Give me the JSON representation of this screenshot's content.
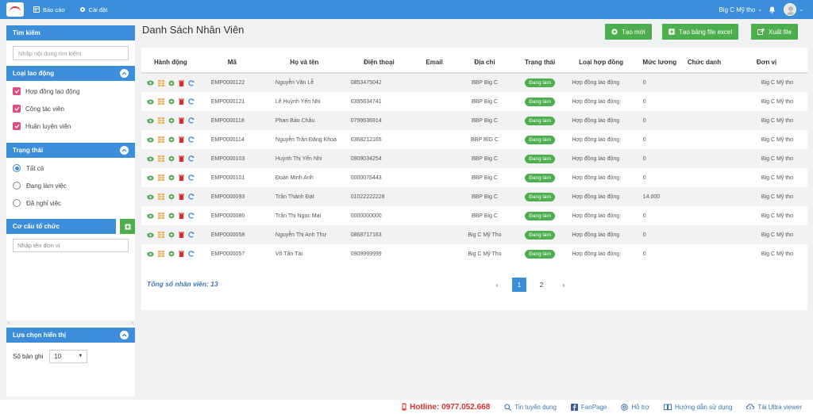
{
  "topbar": {
    "nav": [
      {
        "label": "Báo cáo",
        "icon": "report-icon"
      },
      {
        "label": "Cài đặt",
        "icon": "gear-icon"
      }
    ],
    "store": "Big C Mỹ tho",
    "brand_color": "#3c8dda"
  },
  "sidebar": {
    "search_title": "Tìm kiếm",
    "search_placeholder": "Nhập nội dung tìm kiếm",
    "labor_type_title": "Loại lao động",
    "labor_types": [
      "Hợp đồng lao động",
      "Cộng tác viên",
      "Huấn luyện viên"
    ],
    "status_title": "Trạng thái",
    "status_options": [
      "Tất cả",
      "Đang làm việc",
      "Đã nghỉ việc"
    ],
    "org_title": "Cơ cấu tổ chức",
    "org_placeholder": "Nhập tên đơn vị",
    "display_title": "Lựa chọn hiển thị",
    "records_label": "Số bản ghi",
    "records_value": "10"
  },
  "main": {
    "title": "Danh Sách Nhân Viên",
    "buttons": {
      "create": "Tạo mới",
      "excel": "Tạo bảng file excel",
      "export": "Xuất file"
    },
    "columns": [
      "Hành động",
      "Mã",
      "Họ và tên",
      "Điện thoại",
      "Email",
      "Địa chỉ",
      "Trạng thái",
      "Loại hợp đồng",
      "Mức lương",
      "Chức danh",
      "Đơn vị"
    ],
    "rows": [
      {
        "code": "EMP0000122",
        "name": "Nguyễn Văn Lễ",
        "phone": "0853475042",
        "email": "",
        "address": "BBP Big C",
        "status": "Đang làm",
        "contract": "Hợp đồng lao động",
        "salary": "0",
        "title": "",
        "unit": "Big C Mỹ tho"
      },
      {
        "code": "EMP0000121",
        "name": "Lê Huỳnh Yến Nhi",
        "phone": "0395634741",
        "email": "",
        "address": "BBP Big C",
        "status": "Đang làm",
        "contract": "Hợp đồng lao động",
        "salary": "0",
        "title": "",
        "unit": "Big C Mỹ tho"
      },
      {
        "code": "EMP0000118",
        "name": "Phan Bảo Châu",
        "phone": "0799636914",
        "email": "",
        "address": "BBP Big C",
        "status": "Đang làm",
        "contract": "Hợp đồng lao động",
        "salary": "0",
        "title": "",
        "unit": "Big C Mỹ tho"
      },
      {
        "code": "EMP0000114",
        "name": "Nguyễn Trần Đăng Khoa",
        "phone": "0368212165",
        "email": "",
        "address": "BBP BIG C",
        "status": "Đang làm",
        "contract": "Hợp đồng lao động",
        "salary": "0",
        "title": "",
        "unit": "Big C Mỹ tho"
      },
      {
        "code": "EMP0000103",
        "name": "Huỳnh Thị Yến Nhi",
        "phone": "0909034254",
        "email": "",
        "address": "BBP Big C",
        "status": "Đang làm",
        "contract": "Hợp đồng lao động",
        "salary": "0",
        "title": "",
        "unit": "Big C Mỹ tho"
      },
      {
        "code": "EMP0000101",
        "name": "Đoàn Minh Anh",
        "phone": "0000076443",
        "email": "",
        "address": "BBP Big C",
        "status": "Đang làm",
        "contract": "Hợp đồng lao động",
        "salary": "0",
        "title": "",
        "unit": "Big C Mỹ tho"
      },
      {
        "code": "EMP0000093",
        "name": "Trần Thành Đạt",
        "phone": "01022222228",
        "email": "",
        "address": "BBP Big C",
        "status": "Đang làm",
        "contract": "Hợp đồng lao động",
        "salary": "14.000",
        "title": "",
        "unit": "Big C Mỹ tho"
      },
      {
        "code": "EMP0000080",
        "name": "Trần Thị Ngọc Mai",
        "phone": "0000000000",
        "email": "",
        "address": "BBP Big C",
        "status": "Đang làm",
        "contract": "Hợp đồng lao động",
        "salary": "0",
        "title": "",
        "unit": "Big C Mỹ tho"
      },
      {
        "code": "EMP0000058",
        "name": "Nguyễn Thị Anh Thư",
        "phone": "0868717163",
        "email": "",
        "address": "Big C Mỹ Tho",
        "status": "Đang làm",
        "contract": "Hợp đồng lao động",
        "salary": "0",
        "title": "",
        "unit": "Big C Mỹ tho"
      },
      {
        "code": "EMP0000057",
        "name": "Võ Tấn Tài",
        "phone": "0909999999",
        "email": "",
        "address": "Big C Mỹ Tho",
        "status": "Đang làm",
        "contract": "Hợp đồng lao động",
        "salary": "0",
        "title": "",
        "unit": "Big C Mỹ tho"
      }
    ],
    "total": "Tổng số nhân viên: 13",
    "pagination": {
      "prev": "‹",
      "pages": [
        "1",
        "2"
      ],
      "next": "›",
      "current": "1"
    }
  },
  "footer": {
    "hotline": "Hotline: 0977.052.668",
    "links": [
      "Tin tuyển dụng",
      "FanPage",
      "Hỗ trợ",
      "Hướng dẫn sử dụng",
      "Tải Ultra viewer"
    ]
  }
}
